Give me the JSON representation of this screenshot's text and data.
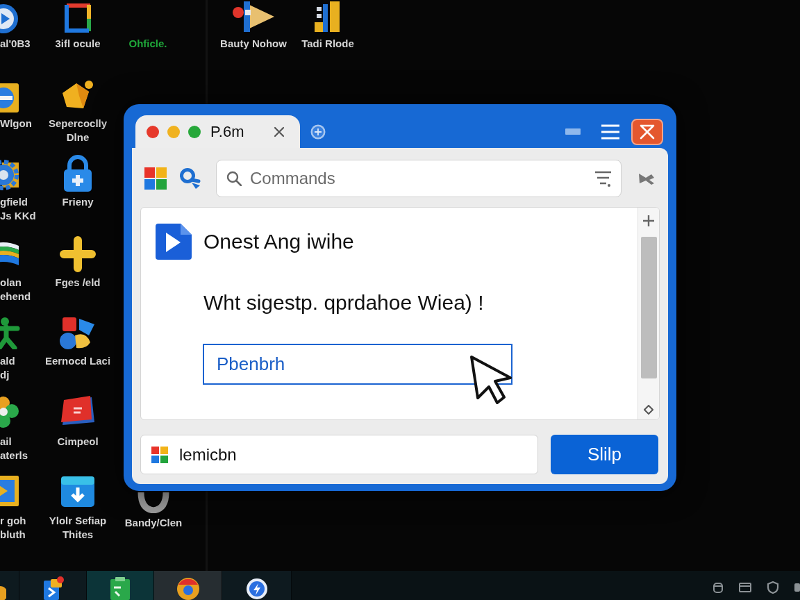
{
  "desktop": {
    "icons": [
      {
        "label": "al'0B3",
        "color": "#d6d6d6"
      },
      {
        "label": "3ifl ocule",
        "color": "#d6d6d6"
      },
      {
        "label": "Ohficle.",
        "color": "#1fa83a"
      },
      {
        "label": "Bauty Nohow",
        "color": "#d6d6d6"
      },
      {
        "label": "Tadi Rlode",
        "color": "#d6d6d6"
      },
      {
        "label": "Wlgon",
        "color": "#d6d6d6"
      },
      {
        "label": "Sepercoclly\nDlne",
        "color": "#d6d6d6"
      },
      {
        "label": "gfield\nJs KKd",
        "color": "#d6d6d6"
      },
      {
        "label": "Frieny",
        "color": "#d6d6d6"
      },
      {
        "label": "olan\nehend",
        "color": "#d6d6d6"
      },
      {
        "label": "Fges /eld",
        "color": "#d6d6d6"
      },
      {
        "label": "ald\ndj",
        "color": "#d6d6d6"
      },
      {
        "label": "Eernocd Laci",
        "color": "#d6d6d6"
      },
      {
        "label": "ail\naterls",
        "color": "#d6d6d6"
      },
      {
        "label": "Cimpeol",
        "color": "#d6d6d6"
      },
      {
        "label": "r goh\nbluth",
        "color": "#d6d6d6"
      },
      {
        "label": "Ylolr Sefiap\nThites",
        "color": "#d6d6d6"
      },
      {
        "label": "Bandy/Clen",
        "color": "#d6d6d6"
      }
    ]
  },
  "window": {
    "tab": {
      "title": "P.6m"
    },
    "search": {
      "placeholder": "Commands"
    },
    "content": {
      "heading": "Onest Ang iwihe",
      "message": "Wht sigestp. qprdahoe Wiea) !",
      "input": {
        "value": "Pbenbrh",
        "focused": true
      }
    },
    "footer": {
      "field": {
        "value": "lemicbn"
      },
      "button": "Slilp"
    }
  },
  "taskbar": {
    "apps": [
      {
        "selected": false,
        "hovered": false
      },
      {
        "selected": false,
        "hovered": false
      },
      {
        "selected": true,
        "hovered": false
      },
      {
        "selected": false,
        "hovered": true
      },
      {
        "selected": false,
        "hovered": false
      }
    ]
  }
}
